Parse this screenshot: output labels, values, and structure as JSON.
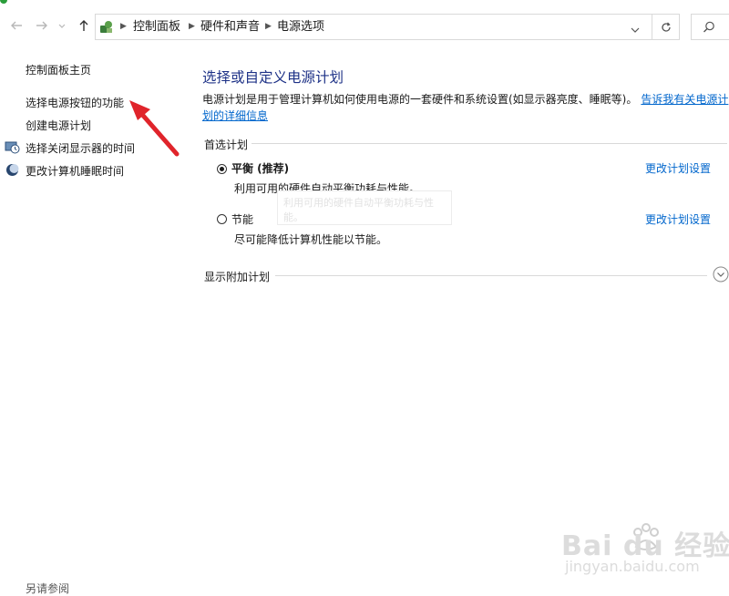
{
  "nav": {
    "back_icon": "back-arrow-icon",
    "forward_icon": "forward-arrow-icon",
    "up_icon": "up-arrow-icon",
    "refresh_icon": "refresh-icon",
    "search_icon": "search-icon"
  },
  "breadcrumb": {
    "items": [
      "控制面板",
      "硬件和声音",
      "电源选项"
    ]
  },
  "sidebar": {
    "items": [
      {
        "label": "控制面板主页"
      },
      {
        "label": "选择电源按钮的功能"
      },
      {
        "label": "创建电源计划"
      },
      {
        "label": "选择关闭显示器的时间"
      },
      {
        "label": "更改计算机睡眠时间"
      }
    ],
    "see_also": "另请参阅"
  },
  "main": {
    "title": "选择或自定义电源计划",
    "description": "电源计划是用于管理计算机如何使用电源的一套硬件和系统设置(如显示器亮度、睡眠等)。",
    "description_link": "告诉我有关电源计划的详细信息",
    "preferred_section": "首选计划",
    "plans": [
      {
        "name": "平衡 (推荐)",
        "description": "利用可用的硬件自动平衡功耗与性能。",
        "link": "更改计划设置",
        "selected": true
      },
      {
        "name": "节能",
        "description": "尽可能降低计算机性能以节能。",
        "link": "更改计划设置",
        "selected": false
      }
    ],
    "extra_section": "显示附加计划",
    "tooltip": "利用可用的硬件自动平衡功耗与性能。"
  },
  "watermark": {
    "logo": "Bai du 经验",
    "domain": "jingyan.baidu.com"
  },
  "colors": {
    "title": "#1e3287",
    "link": "#0066cc",
    "annotation_arrow": "#e0242b"
  }
}
